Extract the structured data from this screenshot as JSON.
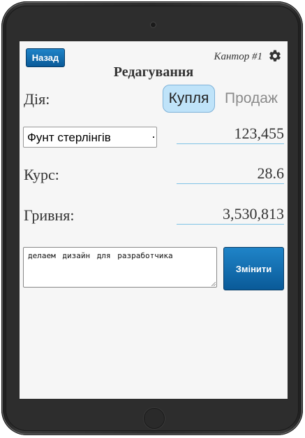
{
  "header": {
    "back_label": "Назад",
    "office_label": "Кантор #1",
    "title": "Редагування",
    "settings_icon": "gear-icon"
  },
  "operation": {
    "label": "Дія:",
    "buy_label": "Купля",
    "sell_label": "Продаж",
    "selected": "buy"
  },
  "currency": {
    "selected": "Фунт стерлінгів",
    "amount": "123,455"
  },
  "rate": {
    "label": "Курс:",
    "value": "28.6"
  },
  "total": {
    "label": "Гривня:",
    "value": "3,530,813"
  },
  "note": {
    "text": "делаем дизайн для разработчика"
  },
  "actions": {
    "change_label": "Змінити"
  },
  "colors": {
    "accent": "#0a5a98",
    "toggle_active": "#bfe3f9",
    "underline": "#7fc3e6",
    "screen_bg": "#f6f6f6"
  }
}
